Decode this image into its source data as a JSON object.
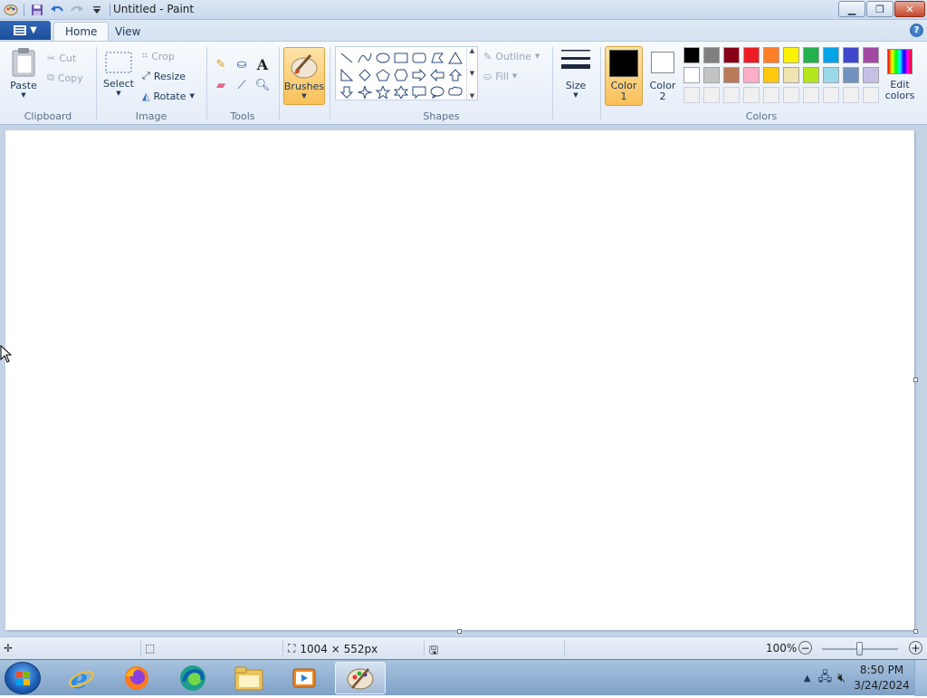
{
  "window": {
    "title": "Untitled - Paint"
  },
  "tabs": [
    {
      "label": "Home"
    },
    {
      "label": "View"
    }
  ],
  "clipboard": {
    "paste": "Paste",
    "cut": "Cut",
    "copy": "Copy",
    "label": "Clipboard"
  },
  "image": {
    "select": "Select",
    "crop": "Crop",
    "resize": "Resize",
    "rotate": "Rotate",
    "label": "Image"
  },
  "tools": {
    "label": "Tools"
  },
  "brushes": {
    "label": "Brushes"
  },
  "shapes": {
    "outline": "Outline",
    "fill": "Fill",
    "label": "Shapes"
  },
  "size": {
    "label": "Size"
  },
  "colors": {
    "color1_a": "Color",
    "color1_b": "1",
    "color2_a": "Color",
    "color2_b": "2",
    "edit_a": "Edit",
    "edit_b": "colors",
    "label": "Colors",
    "color1": "#000000",
    "color2": "#ffffff",
    "row1": [
      "#000000",
      "#7f7f7f",
      "#880015",
      "#ed1c24",
      "#ff7f27",
      "#fff200",
      "#22b14c",
      "#00a2e8",
      "#3f48cc",
      "#a349a4"
    ],
    "row2": [
      "#ffffff",
      "#c3c3c3",
      "#b97a57",
      "#ffaec9",
      "#ffc90e",
      "#efe4b0",
      "#b5e61d",
      "#99d9ea",
      "#7092be",
      "#c8bfe7"
    ],
    "row3": [
      "#f0f0f0",
      "#f0f0f0",
      "#f0f0f0",
      "#f0f0f0",
      "#f0f0f0",
      "#f0f0f0",
      "#f0f0f0",
      "#f0f0f0",
      "#f0f0f0",
      "#f0f0f0"
    ]
  },
  "status": {
    "dimensions": "1004 × 552px",
    "zoom": "100%",
    "zoom_level": 1.0
  },
  "taskbar": {
    "time": "8:50 PM",
    "date": "3/24/2024"
  }
}
